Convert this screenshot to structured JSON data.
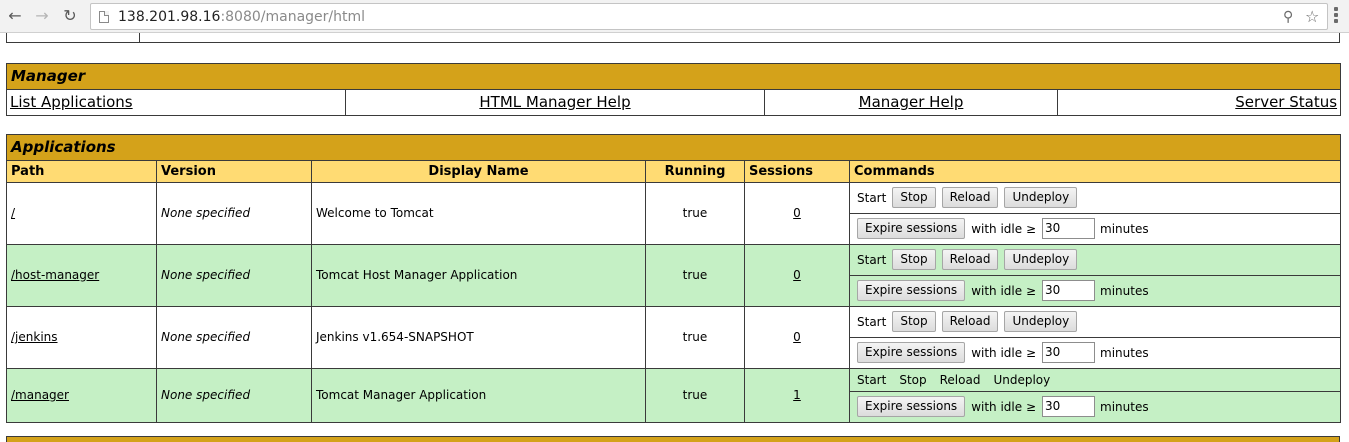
{
  "browser": {
    "url_host": "138.201.98.16",
    "url_rest": ":8080/manager/html"
  },
  "manager": {
    "title": "Manager",
    "links": [
      "List Applications",
      "HTML Manager Help",
      "Manager Help",
      "Server Status"
    ]
  },
  "applications": {
    "title": "Applications",
    "headers": {
      "path": "Path",
      "version": "Version",
      "display_name": "Display Name",
      "running": "Running",
      "sessions": "Sessions",
      "commands": "Commands"
    },
    "commands": {
      "start": "Start",
      "stop": "Stop",
      "reload": "Reload",
      "undeploy": "Undeploy",
      "expire": "Expire sessions",
      "with_idle": "with idle ≥",
      "minutes": "minutes"
    },
    "rows": [
      {
        "path": "/",
        "version": "None specified",
        "display_name": "Welcome to Tomcat",
        "running": "true",
        "sessions": "0",
        "idle": "30"
      },
      {
        "path": "/host-manager",
        "version": "None specified",
        "display_name": "Tomcat Host Manager Application",
        "running": "true",
        "sessions": "0",
        "idle": "30"
      },
      {
        "path": "/jenkins",
        "version": "None specified",
        "display_name": "Jenkins v1.654-SNAPSHOT",
        "running": "true",
        "sessions": "0",
        "idle": "30"
      },
      {
        "path": "/manager",
        "version": "None specified",
        "display_name": "Tomcat Manager Application",
        "running": "true",
        "sessions": "1",
        "idle": "30"
      }
    ]
  },
  "colors": {
    "section_header": "#d4a21a",
    "column_header": "#ffdb73",
    "row_alt": "#c5f0c5"
  }
}
